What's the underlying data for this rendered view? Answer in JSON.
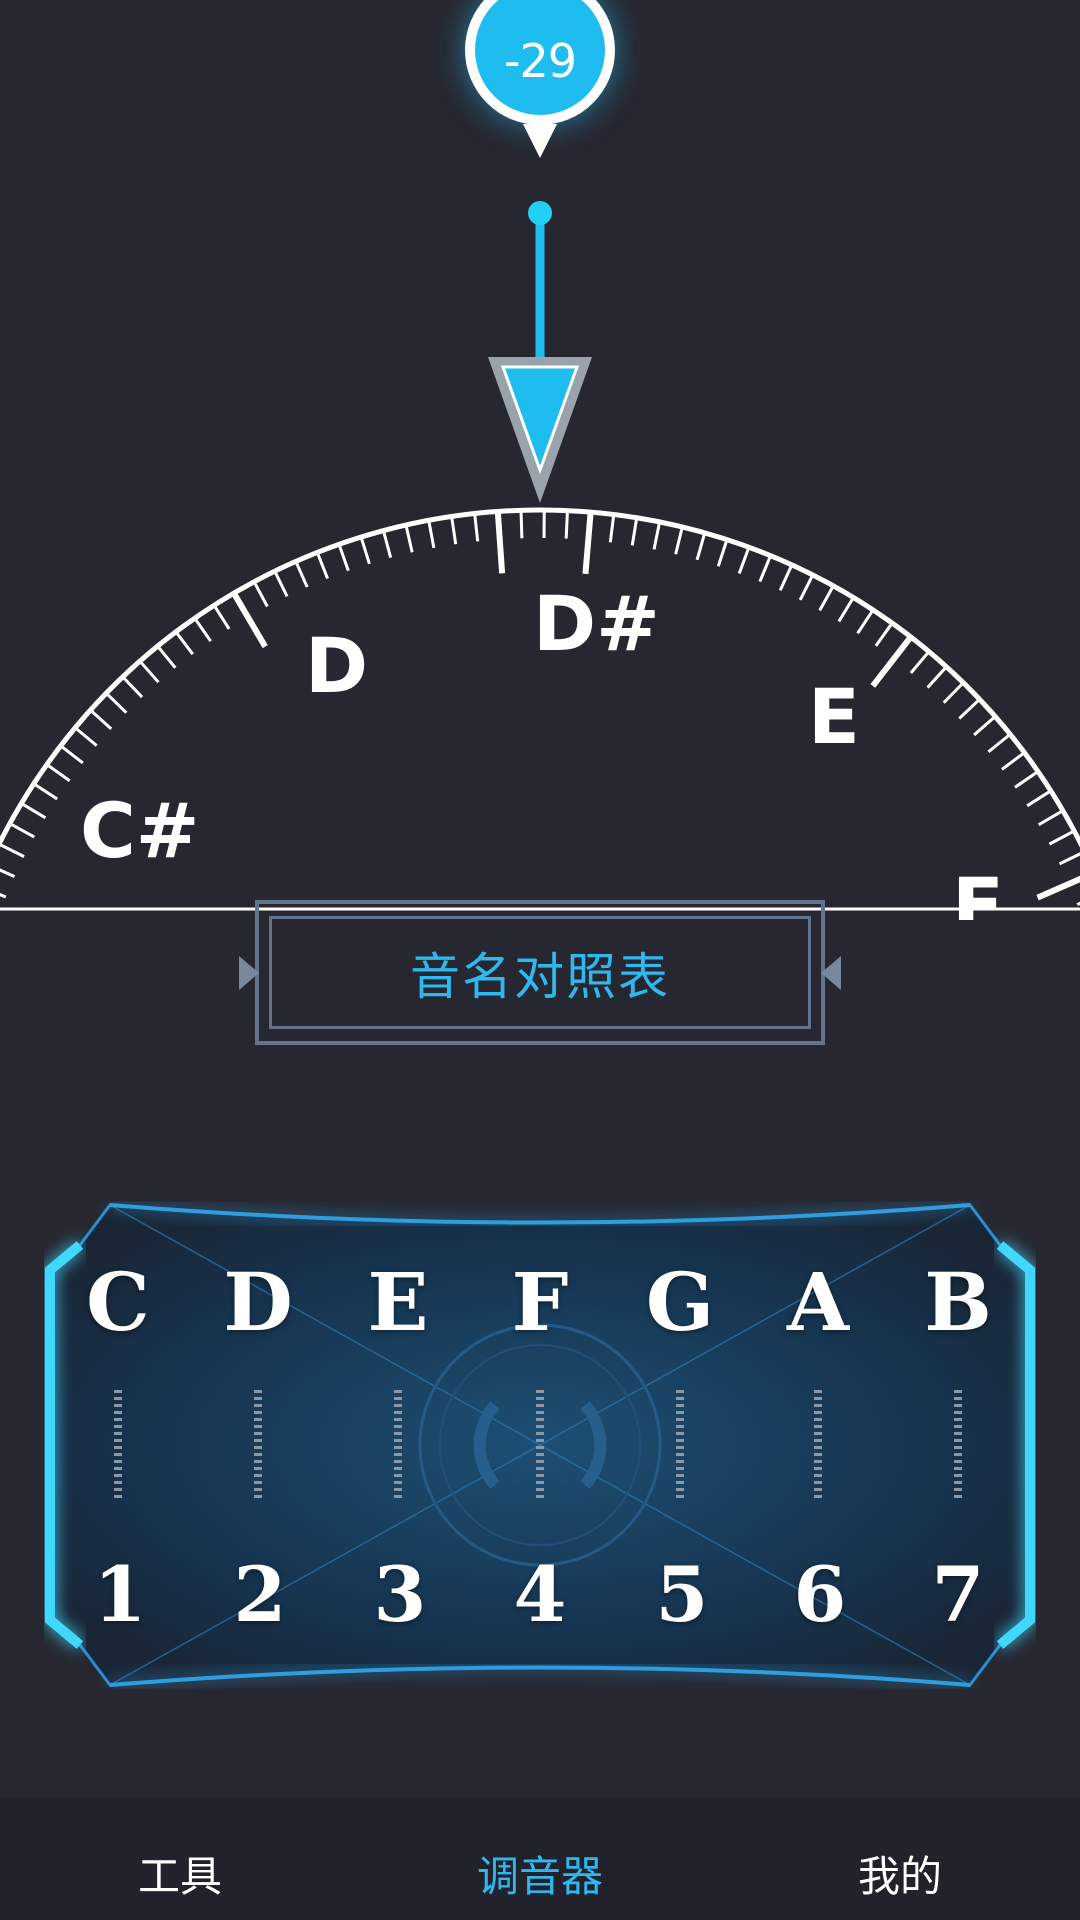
{
  "tuner": {
    "cents_value": "-29",
    "scale_notes": [
      "C#",
      "D",
      "D#",
      "E",
      "F"
    ],
    "accent_color": "#1fbcef"
  },
  "note_table_button": {
    "label": "音名对照表"
  },
  "note_panel": {
    "letters": [
      "C",
      "D",
      "E",
      "F",
      "G",
      "A",
      "B"
    ],
    "numbers": [
      "1",
      "2",
      "3",
      "4",
      "5",
      "6",
      "7"
    ],
    "glow_color": "#3fd8ff"
  },
  "bottom_nav": {
    "items": [
      {
        "label": "工具",
        "active": false
      },
      {
        "label": "调音器",
        "active": true
      },
      {
        "label": "我的",
        "active": false
      }
    ],
    "active_color": "#2fb8ef"
  }
}
